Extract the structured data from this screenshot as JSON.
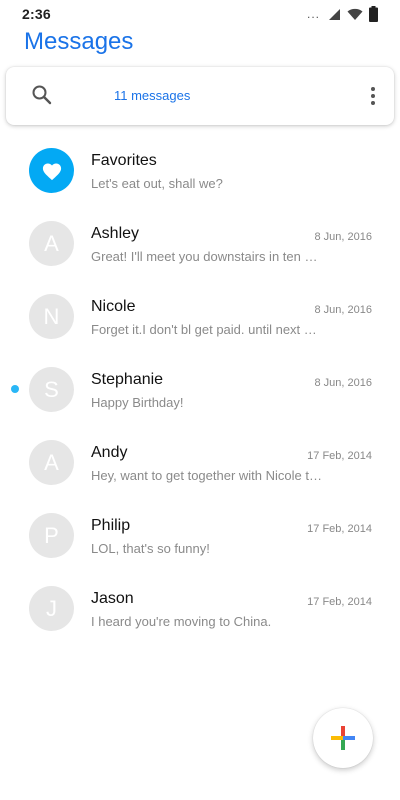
{
  "status_bar": {
    "time": "2:36",
    "dots": "...",
    "icons": [
      "signal-icon",
      "wifi-icon",
      "battery-icon"
    ]
  },
  "header": {
    "title": "Messages"
  },
  "search": {
    "count_label": "11 messages",
    "icons": [
      "search-icon",
      "more-vert-icon"
    ]
  },
  "conversations": [
    {
      "avatar": "",
      "name": "Favorites",
      "date": "",
      "preview": "Let's eat out, shall we?",
      "unread": false,
      "icon": "heart-icon"
    },
    {
      "avatar": "A",
      "name": "Ashley",
      "date": "8 Jun, 2016",
      "preview": "Great! I'll meet you downstairs in ten minutes",
      "unread": false
    },
    {
      "avatar": "N",
      "name": "Nicole",
      "date": "8 Jun, 2016",
      "preview": "Forget it.I don't bl get paid. until next Friday",
      "unread": false
    },
    {
      "avatar": "S",
      "name": "Stephanie",
      "date": "8 Jun, 2016",
      "preview": "Happy Birthday!",
      "unread": true
    },
    {
      "avatar": "A",
      "name": "Andy",
      "date": "17 Feb, 2014",
      "preview": "Hey, want to get together with Nicole tonight?",
      "unread": false
    },
    {
      "avatar": "P",
      "name": "Philip",
      "date": "17 Feb, 2014",
      "preview": "LOL, that's so funny!",
      "unread": false
    },
    {
      "avatar": "J",
      "name": "Jason",
      "date": "17 Feb, 2014",
      "preview": "I heard you're moving to China.",
      "unread": false
    }
  ],
  "fab": {
    "icon": "plus-icon",
    "colors": [
      "#4285F4",
      "#EA4335",
      "#FBBC05",
      "#34A853"
    ]
  },
  "colors": {
    "accent": "#1a73e8",
    "favorites": "#03a9f4",
    "unread": "#29b6f6",
    "avatar_bg": "#e6e6e6"
  }
}
